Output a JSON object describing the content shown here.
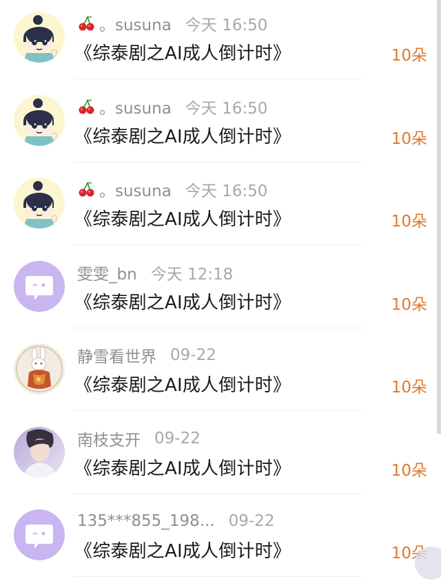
{
  "records": [
    {
      "avatar": "cartoon-boy-avatar",
      "emoji": "cherry-icon",
      "name": "。susuna",
      "time": "今天 16:50",
      "title": "《综泰剧之AI成人倒计时》",
      "gift": "10朵"
    },
    {
      "avatar": "cartoon-boy-avatar",
      "emoji": "cherry-icon",
      "name": "。susuna",
      "time": "今天 16:50",
      "title": "《综泰剧之AI成人倒计时》",
      "gift": "10朵"
    },
    {
      "avatar": "cartoon-boy-avatar",
      "emoji": "cherry-icon",
      "name": "。susuna",
      "time": "今天 16:50",
      "title": "《综泰剧之AI成人倒计时》",
      "gift": "10朵"
    },
    {
      "avatar": "default-chat-avatar",
      "emoji": "",
      "name": "雯雯_bn",
      "time": "今天 12:18",
      "title": "《综泰剧之AI成人倒计时》",
      "gift": "10朵"
    },
    {
      "avatar": "rabbit-avatar",
      "emoji": "",
      "name": "静雪看世界",
      "time": "09-22",
      "title": "《综泰剧之AI成人倒计时》",
      "gift": "10朵"
    },
    {
      "avatar": "photo-avatar",
      "emoji": "",
      "name": "南枝支开",
      "time": "09-22",
      "title": "《综泰剧之AI成人倒计时》",
      "gift": "10朵"
    },
    {
      "avatar": "default-chat-avatar",
      "emoji": "",
      "name": "135***855_198...",
      "time": "09-22",
      "title": "《综泰剧之AI成人倒计时》",
      "gift": "10朵"
    }
  ],
  "colors": {
    "gift": "#e0782b",
    "name": "#8f8f8f",
    "title": "#1a1a1a",
    "default_avatar_bg": "#c9b6f0"
  }
}
